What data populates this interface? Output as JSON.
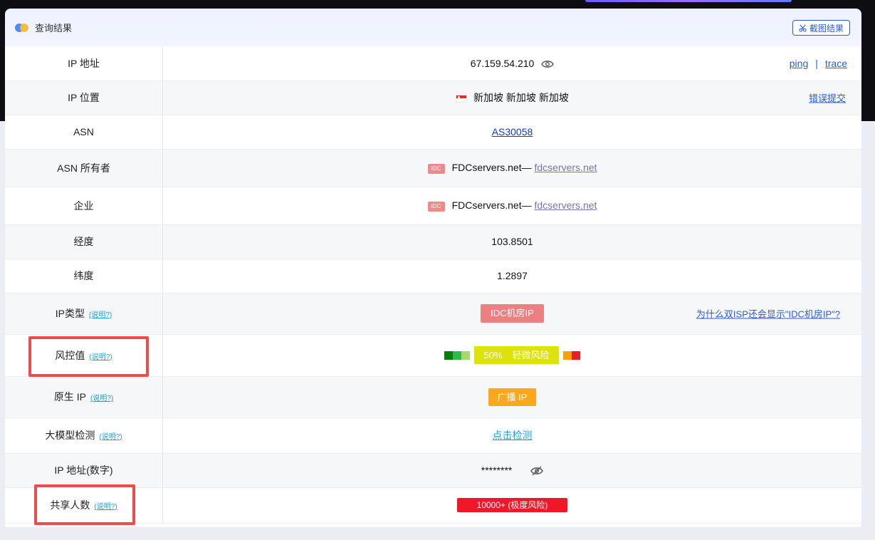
{
  "header": {
    "title": "查询结果",
    "screenshot_button": "截图结果"
  },
  "rows": {
    "ip": {
      "key": "IP 地址",
      "value": "67.159.54.210",
      "ping": "ping",
      "sep": "|",
      "trace": "trace"
    },
    "location": {
      "key": "IP 位置",
      "value": "新加坡 新加坡 新加坡",
      "report": "错误提交"
    },
    "asn": {
      "key": "ASN",
      "value": "AS30058"
    },
    "asn_owner": {
      "key": "ASN 所有者",
      "badge": "IDC",
      "name": "FDCservers.net—",
      "domain": "fdcservers.net"
    },
    "company": {
      "key": "企业",
      "badge": "IDC",
      "name": "FDCservers.net—",
      "domain": "fdcservers.net"
    },
    "longitude": {
      "key": "经度",
      "value": "103.8501"
    },
    "latitude": {
      "key": "纬度",
      "value": "1.2897"
    },
    "ip_type": {
      "key": "IP类型",
      "help": "(说明?)",
      "value": "IDC机房IP",
      "why": "为什么双ISP还会显示\"IDC机房IP\"?"
    },
    "risk": {
      "key": "风控值",
      "help": "(说明?)",
      "percent": "50%",
      "label": "轻微风险",
      "level": 0.5
    },
    "native": {
      "key": "原生 IP",
      "help": "(说明?)",
      "value": "广播 IP"
    },
    "llm": {
      "key": "大模型检测",
      "help": "(说明?)",
      "value": "点击检测"
    },
    "ip_numeric": {
      "key": "IP 地址(数字)",
      "value": "********"
    },
    "shared": {
      "key": "共享人数",
      "help": "(说明?)",
      "value": "10000+ (极度风险)"
    }
  },
  "colors": {
    "risk_segments_low": [
      "#0a7d0a",
      "#33b84a",
      "#a6d86b"
    ],
    "risk_segments_high": [
      "#f5a10a",
      "#e52222"
    ],
    "accent": "#2b5bd7",
    "highlight_box": "#ee4b4b"
  }
}
